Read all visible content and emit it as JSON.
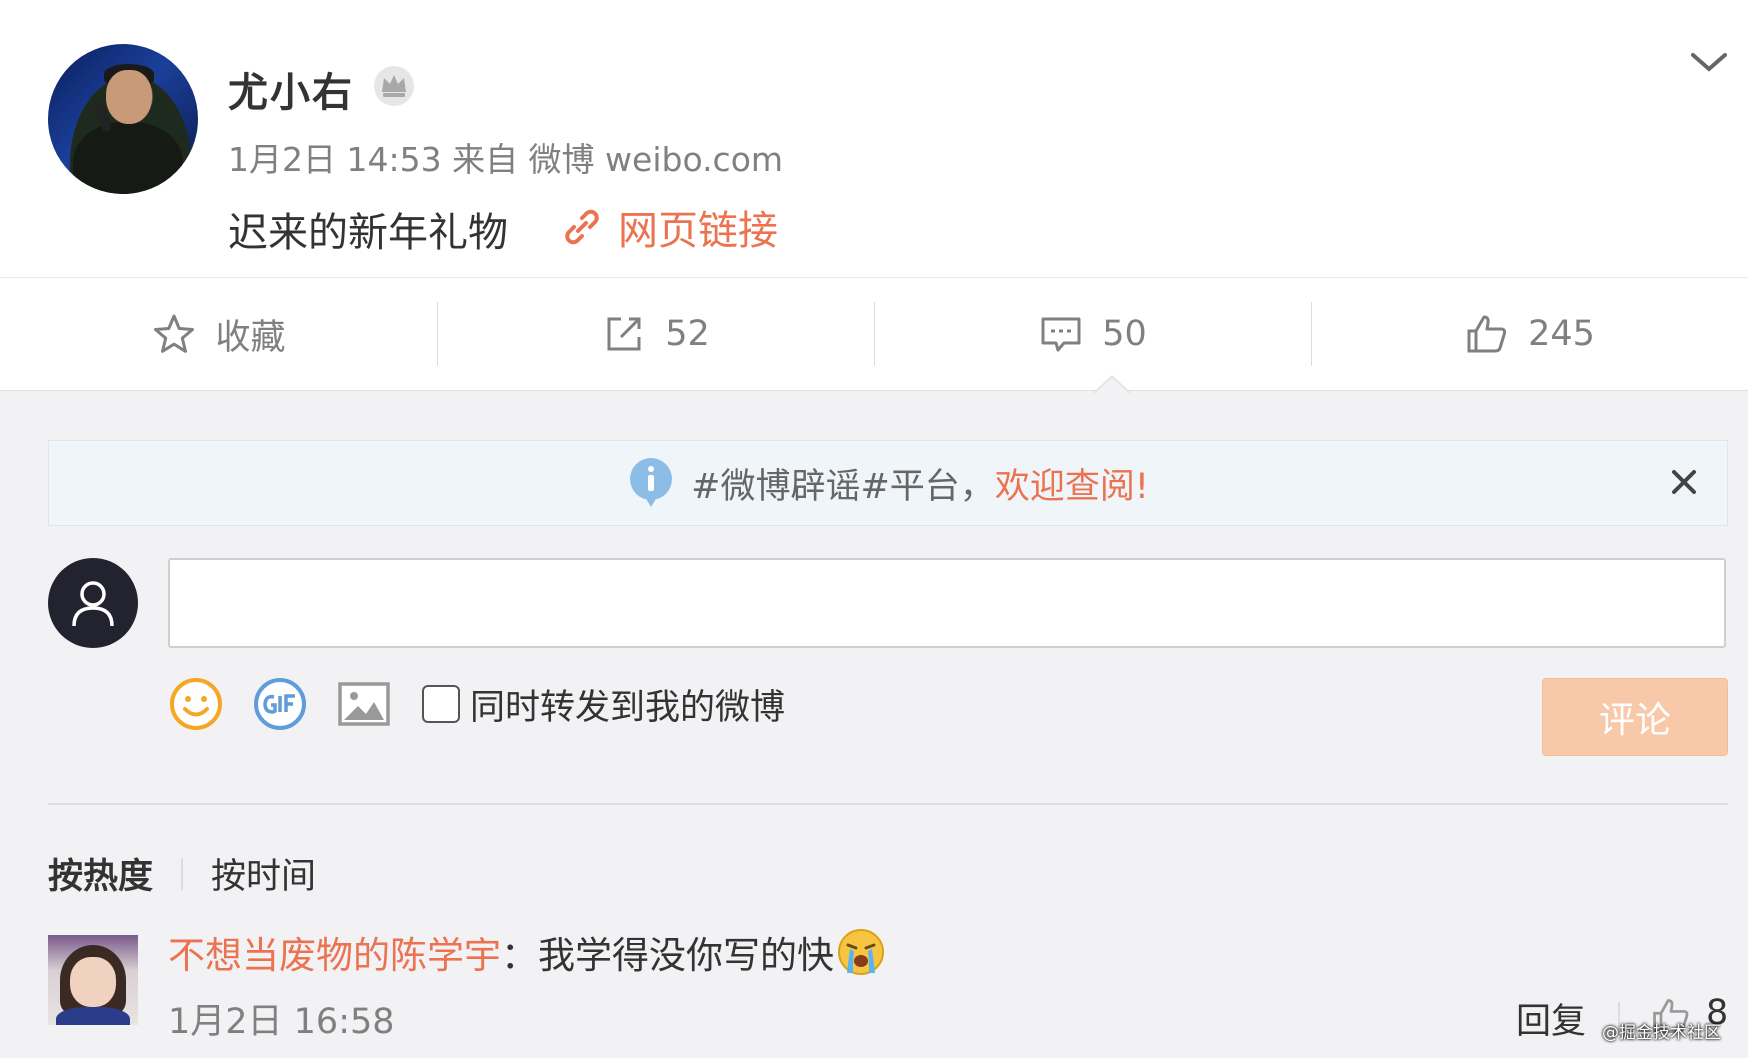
{
  "post": {
    "username": "尤小右",
    "meta": "1月2日 14:53 来自 微博 weibo.com",
    "text": "迟来的新年礼物",
    "link_label": "网页链接"
  },
  "actions": {
    "favorite_label": "收藏",
    "repost_count": "52",
    "comment_count": "50",
    "like_count": "245"
  },
  "notice": {
    "text": "#微博辟谣#平台，",
    "highlight": "欢迎查阅!"
  },
  "composer": {
    "input_value": "",
    "repost_checkbox_label": "同时转发到我的微博",
    "submit_label": "评论"
  },
  "sort": {
    "by_hot": "按热度",
    "by_time": "按时间"
  },
  "comments": [
    {
      "user": "不想当废物的陈学宇",
      "separator": "：",
      "text": "我学得没你写的快",
      "time": "1月2日 16:58",
      "reply_label": "回复",
      "likes": "8"
    }
  ],
  "watermark": "@掘金技术社区",
  "colors": {
    "accent": "#eb7350",
    "submit_disabled": "#f7c9a9",
    "notice_bg": "#f0f5fa",
    "page_bg": "#f2f2f5"
  },
  "icons": [
    "crown-icon",
    "link-icon",
    "chevron-down-icon",
    "star-icon",
    "share-icon",
    "comment-icon",
    "thumbs-up-icon",
    "info-icon",
    "close-icon",
    "user-icon",
    "smiley-icon",
    "gif-icon",
    "image-icon",
    "crying-emoji-icon"
  ]
}
